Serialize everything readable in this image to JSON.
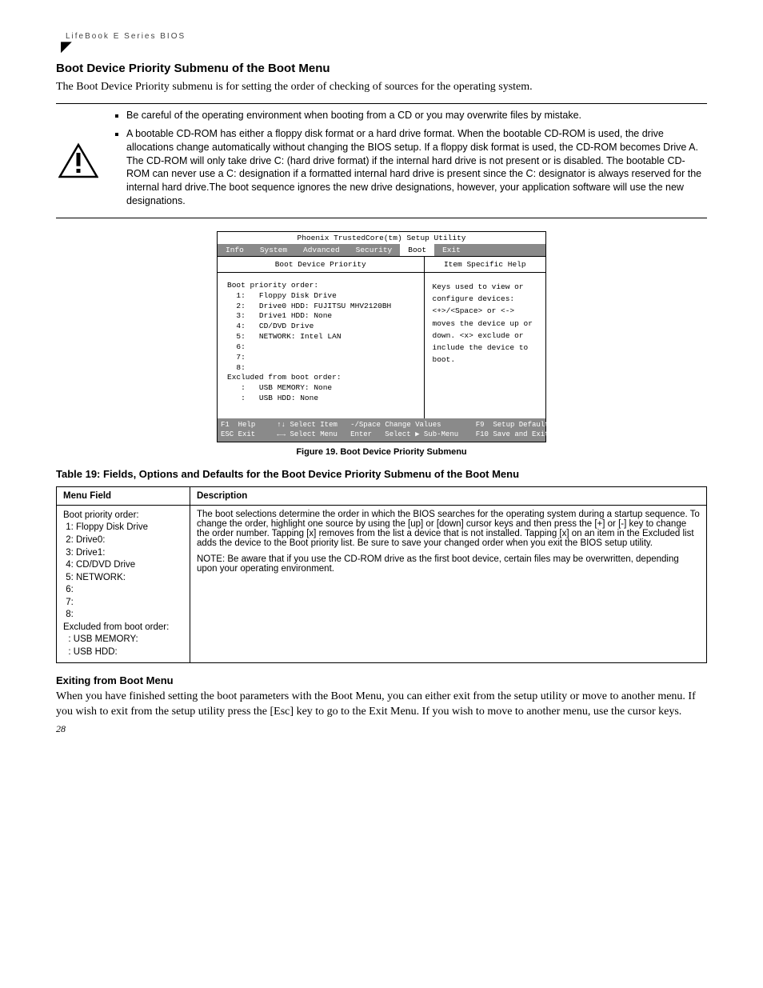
{
  "header": {
    "breadcrumb": "LifeBook E Series BIOS"
  },
  "section": {
    "title": "Boot Device Priority Submenu of the Boot Menu",
    "intro": "The Boot Device Priority submenu is for setting the order of checking of sources for the operating system."
  },
  "warnings": {
    "bullet1": "Be careful of the operating environment when booting from a CD or you may overwrite files by mistake.",
    "bullet2": "A bootable CD-ROM has either a floppy disk format or a hard drive format. When the bootable CD-ROM is used, the drive allocations change automatically without changing the BIOS setup. If a floppy disk format is used, the CD-ROM becomes Drive A. The CD-ROM will only take drive C: (hard drive format) if the internal hard drive is not present or is disabled. The bootable CD-ROM can never use a C: designation if a formatted internal hard drive is present since the C: designator is always reserved for the internal hard drive.The boot sequence ignores the new drive designations, however, your application software will use the new designations."
  },
  "bios": {
    "utility_title": "Phoenix TrustedCore(tm) Setup Utility",
    "tabs": {
      "info": "Info",
      "system": "System",
      "advanced": "Advanced",
      "security": "Security",
      "boot": "Boot",
      "exit": "Exit"
    },
    "left_header": "Boot Device Priority",
    "right_header": "Item Specific Help",
    "left_body": "Boot priority order:\n  1:   Floppy Disk Drive\n  2:   Drive0 HDD: FUJITSU MHV2120BH\n  3:   Drive1 HDD: None\n  4:   CD/DVD Drive\n  5:   NETWORK: Intel LAN\n  6:\n  7:\n  8:\nExcluded from boot order:\n   :   USB MEMORY: None\n   :   USB HDD: None",
    "right_body": "Keys used to view or configure devices:\n\n<+>/<Space> or <-> moves the device up or down.\n<x> exclude or include the device to boot.",
    "footer": {
      "f1": "F1",
      "help": "Help",
      "esc": "ESC",
      "exit": "Exit",
      "arrows_v": "↑↓",
      "select_item": "Select Item",
      "arrows_h": "←→",
      "select_menu": "Select Menu",
      "minus_space": "-/Space",
      "change_values": "Change Values",
      "enter": "Enter",
      "sub_menu": "Select ▶ Sub-Menu",
      "f9": "F9",
      "setup_defaults": "Setup Defaults",
      "f10": "F10",
      "save_exit": "Save and Exit"
    }
  },
  "figure_caption": "Figure 19.  Boot Device Priority Submenu",
  "table": {
    "title": "Table 19: Fields, Options and Defaults for the Boot Device Priority Submenu of the Boot Menu",
    "head_field": "Menu Field",
    "head_desc": "Description",
    "row_field": "Boot priority order:\n 1: Floppy Disk Drive\n 2: Drive0:\n 3: Drive1:\n 4: CD/DVD Drive\n 5: NETWORK:\n 6:\n 7:\n 8:\nExcluded from boot order:\n  : USB MEMORY:\n  : USB HDD:",
    "row_desc_p1": "The boot selections determine the order in which the BIOS searches for the operating system during a startup sequence. To change the order, highlight one source by using the [up] or [down] cursor keys and then press the [+] or [-] key to change the order number. Tapping [x] removes from the list a device that is not installed. Tapping [x] on an item in the Excluded list adds the device to the Boot priority list. Be sure to save your changed order when you exit the BIOS setup utility.",
    "row_desc_p2": "NOTE: Be aware that if you use the CD-ROM drive as the first boot device, certain files may be overwritten, depending upon your operating environment."
  },
  "exit": {
    "heading": "Exiting from Boot Menu",
    "body": "When you have finished setting the boot parameters with the Boot Menu, you can either exit from the setup utility or move to another menu. If you wish to exit from the setup utility press the [Esc] key to go to the Exit Menu. If you wish to move to another menu, use the cursor keys."
  },
  "page_number": "28"
}
